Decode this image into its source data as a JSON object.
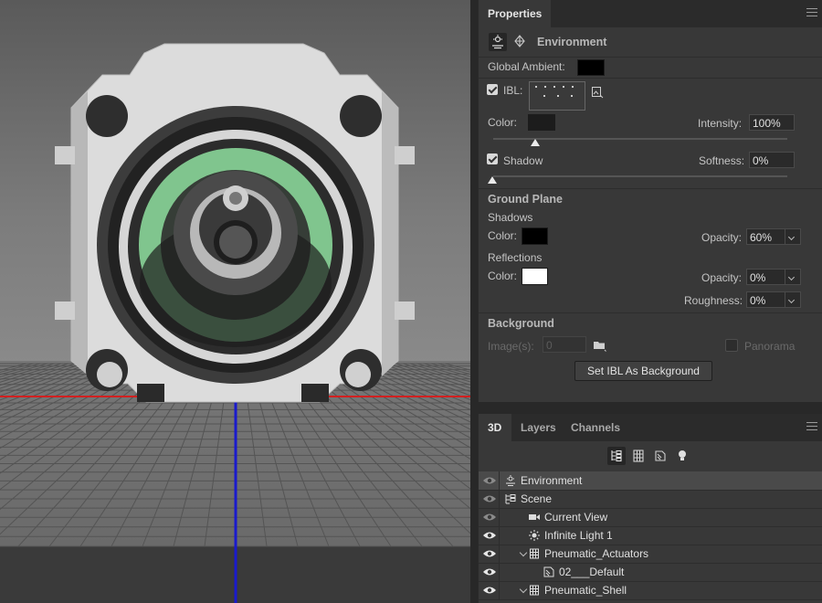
{
  "properties": {
    "tab": "Properties",
    "section_title": "Environment",
    "global_ambient_label": "Global Ambient:",
    "global_ambient_color": "#000000",
    "ibl_label": "IBL:",
    "ibl_checked": true,
    "color_label": "Color:",
    "ibl_color": "#1c1c1c",
    "intensity_label": "Intensity:",
    "intensity_value": "100%",
    "shadow_label": "Shadow",
    "shadow_checked": true,
    "softness_label": "Softness:",
    "softness_value": "0%",
    "ground_plane": {
      "title": "Ground Plane",
      "shadows_label": "Shadows",
      "shadows_color_label": "Color:",
      "shadows_color": "#000000",
      "shadows_opacity_label": "Opacity:",
      "shadows_opacity": "60%",
      "reflections_label": "Reflections",
      "reflections_color_label": "Color:",
      "reflections_color": "#ffffff",
      "reflections_opacity_label": "Opacity:",
      "reflections_opacity": "0%",
      "roughness_label": "Roughness:",
      "roughness_value": "0%"
    },
    "background": {
      "title": "Background",
      "images_label": "Image(s):",
      "images_value": "0",
      "panorama_label": "Panorama",
      "panorama_checked": false,
      "set_ibl_button": "Set IBL As Background"
    }
  },
  "panel3d": {
    "tabs": [
      "3D",
      "Layers",
      "Channels"
    ],
    "active_tab": "3D",
    "filter_tools": [
      "whole-scene-filter-icon",
      "meshes-filter-icon",
      "materials-filter-icon",
      "lights-filter-icon"
    ],
    "layers": [
      {
        "name": "Environment",
        "icon": "environment-icon",
        "indent": 0,
        "selected": true,
        "eye": "dim"
      },
      {
        "name": "Scene",
        "icon": "scene-icon",
        "indent": 0,
        "selected": false,
        "eye": "dim"
      },
      {
        "name": "Current View",
        "icon": "camera-icon",
        "indent": 1,
        "selected": false,
        "eye": "dim"
      },
      {
        "name": "Infinite Light 1",
        "icon": "light-icon",
        "indent": 1,
        "selected": false,
        "eye": "on"
      },
      {
        "name": "Pneumatic_Actuators",
        "icon": "mesh-icon",
        "indent": 1,
        "selected": false,
        "eye": "on",
        "expanded": true
      },
      {
        "name": "02___Default",
        "icon": "material-icon",
        "indent": 2,
        "selected": false,
        "eye": "on"
      },
      {
        "name": "Pneumatic_Shell",
        "icon": "mesh-icon",
        "indent": 1,
        "selected": false,
        "eye": "on",
        "expanded": true
      }
    ]
  },
  "viewport": {
    "ground_axis_x_color": "#d22020",
    "ground_axis_z_color": "#1a1acc",
    "highlight_color": "#8fe0a0"
  }
}
